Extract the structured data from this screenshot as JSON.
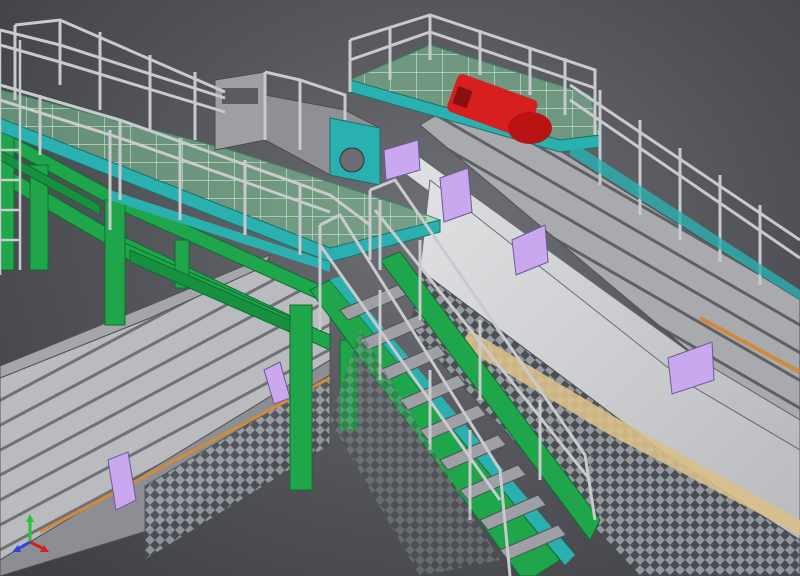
{
  "viewport": {
    "background_center": "#6e7075",
    "background_edge": "#3b3d41"
  },
  "colors": {
    "structure_green": "#1fa54a",
    "structure_green_dark": "#0f6e2e",
    "teal_panel": "#2bb0b0",
    "steel_grey": "#a9abb0",
    "steel_light": "#d8d9dc",
    "steel_dark": "#6a6c70",
    "lavender_bracket": "#c9a8f0",
    "drive_red": "#d81f1f",
    "wood_tan": "#d9bf8a",
    "grating_glass": "#8fd6a0"
  },
  "icons": {
    "triad": "axis-triad-icon",
    "drive_motor": "drive-motor-icon"
  }
}
